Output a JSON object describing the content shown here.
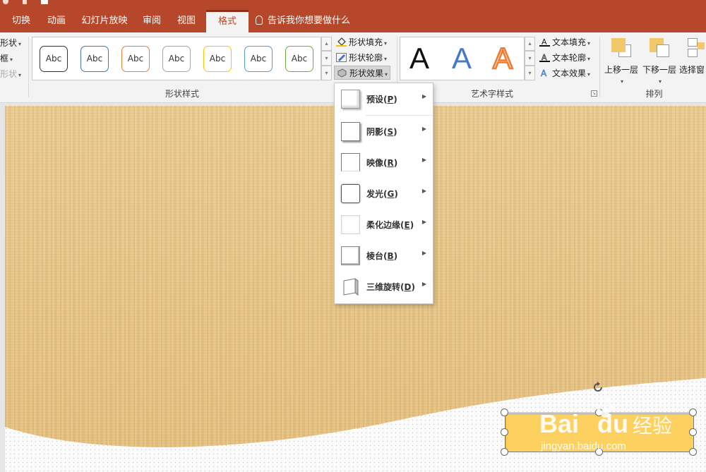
{
  "tabs": [
    {
      "label": "切换"
    },
    {
      "label": "动画"
    },
    {
      "label": "幻灯片放映"
    },
    {
      "label": "审阅"
    },
    {
      "label": "视图"
    },
    {
      "label": "格式"
    }
  ],
  "active_tab": "格式",
  "tell_me": "告诉我你想要做什么",
  "ribbon": {
    "left_partial": {
      "shape": "形状",
      "border": "框",
      "shape2": "形状"
    },
    "shape_styles": {
      "label": "形状样式",
      "items": [
        {
          "text": "Abc",
          "color": "#333333"
        },
        {
          "text": "Abc",
          "color": "#4472c4"
        },
        {
          "text": "Abc",
          "color": "#ed7d31"
        },
        {
          "text": "Abc",
          "color": "#a5a5a5"
        },
        {
          "text": "Abc",
          "color": "#ffc000"
        },
        {
          "text": "Abc",
          "color": "#5b9bd5"
        },
        {
          "text": "Abc",
          "color": "#70ad47"
        }
      ]
    },
    "shape_fill": "形状填充",
    "shape_outline": "形状轮廓",
    "shape_effects": "形状效果",
    "wordart": {
      "label": "艺术字样式",
      "letter": "A",
      "styles": [
        {
          "color": "#111111"
        },
        {
          "color": "#4472c4"
        },
        {
          "color": "#ed7d31"
        }
      ]
    },
    "text_fill": "文本填充",
    "text_outline": "文本轮廓",
    "text_effects": "文本效果",
    "arrange": {
      "label": "排列",
      "bring_forward": "上移一层",
      "send_backward": "下移一层",
      "selection_pane": "选择窗"
    }
  },
  "shape_effects_menu": [
    {
      "label": "预设",
      "key": "P",
      "icon": "preset-icon"
    },
    {
      "label": "阴影",
      "key": "S",
      "icon": "shadow-icon"
    },
    {
      "label": "映像",
      "key": "R",
      "icon": "reflection-icon"
    },
    {
      "label": "发光",
      "key": "G",
      "icon": "glow-icon"
    },
    {
      "label": "柔化边缘",
      "key": "E",
      "icon": "soft-edges-icon"
    },
    {
      "label": "棱台",
      "key": "B",
      "icon": "bevel-icon"
    },
    {
      "label": "三维旋转",
      "key": "D",
      "icon": "3d-rotation-icon"
    }
  ],
  "watermark": {
    "brand": "Bai",
    "brand2": "du",
    "cn": "经验",
    "url": "jingyan.baidu.com"
  },
  "colors": {
    "accent": "#b7472a",
    "slide_texture": "#e6c489",
    "selected_shape": "#fcd15f"
  }
}
